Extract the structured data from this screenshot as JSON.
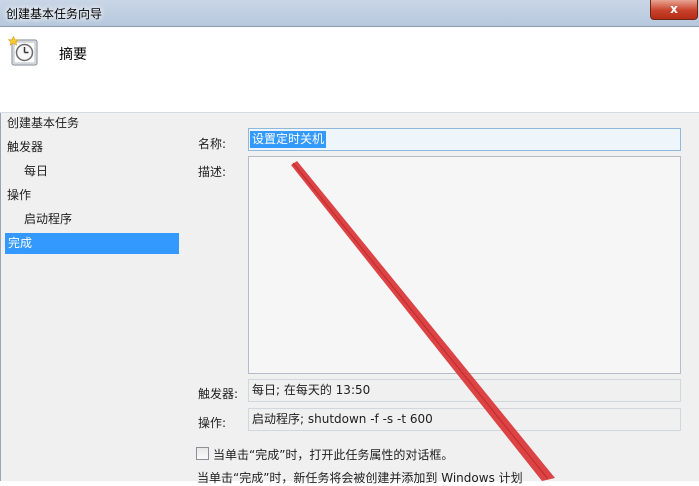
{
  "window": {
    "title": "创建基本任务向导",
    "close_label": "x"
  },
  "header": {
    "heading": "摘要",
    "icon": "clock-task-icon"
  },
  "nav": {
    "items": [
      {
        "label": "创建基本任务"
      },
      {
        "label": "触发器"
      },
      {
        "label": "每日"
      },
      {
        "label": "操作"
      },
      {
        "label": "启动程序"
      },
      {
        "label": "完成"
      }
    ]
  },
  "form": {
    "name_label": "名称:",
    "name_value": "设置定时关机",
    "desc_label": "描述:",
    "desc_value": "",
    "trigger_label": "触发器:",
    "trigger_value": "每日; 在每天的 13:50",
    "action_label": "操作:",
    "action_value": "启动程序; shutdown -f -s -t 600"
  },
  "footer": {
    "checkbox_label": "当单击“完成”时，打开此任务属性的对话框。",
    "checkbox_checked": false,
    "note_text": "当单击“完成”时，新任务将会被创建并添加到 Windows 计划"
  },
  "colors": {
    "selection": "#3399ff",
    "annotation_arrow": "#d9393a"
  }
}
